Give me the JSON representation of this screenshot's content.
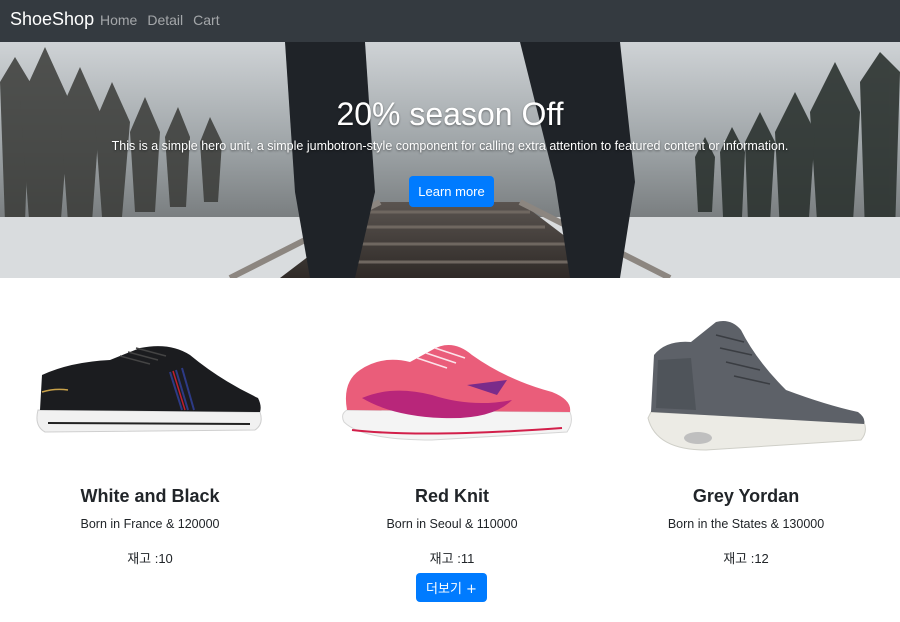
{
  "navbar": {
    "brand": "ShoeShop",
    "links": [
      "Home",
      "Detail",
      "Cart"
    ]
  },
  "hero": {
    "title": "20% season Off",
    "text": "This is a simple hero unit, a simple jumbotron-style component for calling extra attention to featured content or information.",
    "button": "Learn more"
  },
  "products": [
    {
      "title": "White and Black",
      "desc": "Born in France & 120000",
      "stock": "재고 :10",
      "image": "black-sneaker"
    },
    {
      "title": "Red Knit",
      "desc": "Born in Seoul & 110000",
      "stock": "재고 :11",
      "image": "pink-running-shoe"
    },
    {
      "title": "Grey Yordan",
      "desc": "Born in the States & 130000",
      "stock": "재고 :12",
      "image": "grey-high-top-sneaker"
    }
  ],
  "more_button": "더보기 +",
  "colors": {
    "navbar": "#343a40",
    "primary": "#007bff"
  }
}
